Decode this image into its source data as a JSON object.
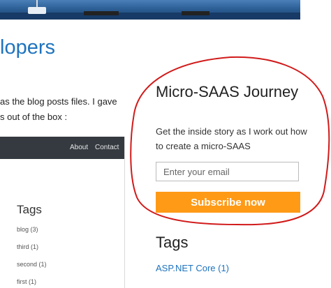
{
  "blog": {
    "title": "lopers"
  },
  "post": {
    "lines": [
      "as the blog posts files. I gave",
      "s out of the box :"
    ]
  },
  "embedded_screenshot": {
    "nav": {
      "about": "About",
      "contact": "Contact"
    },
    "tags_title": "Tags",
    "tags": [
      "blog (3)",
      "third (1)",
      "second (1)",
      "first (1)"
    ]
  },
  "subscribe_widget": {
    "title": "Micro-SAAS Journey",
    "description": "Get the inside story as I work out how to create a micro-SAAS",
    "email_placeholder": "Enter your email",
    "button_label": "Subscribe now",
    "accent_color": "#ff9a17",
    "highlight_color": "#d11a1a"
  },
  "sidebar_tags": {
    "title": "Tags",
    "items": [
      "ASP.NET Core (1)"
    ]
  }
}
